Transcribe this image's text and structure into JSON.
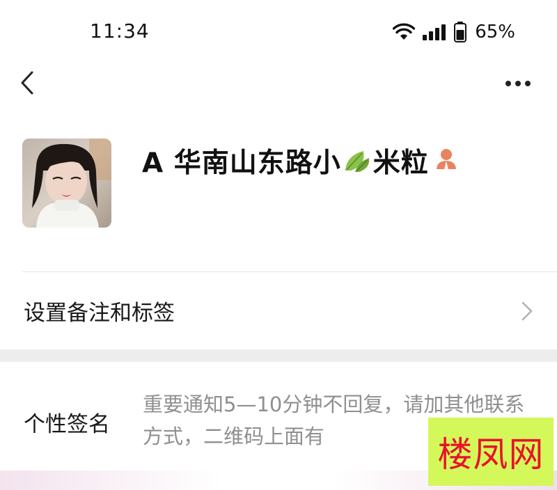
{
  "status_bar": {
    "time": "11:34",
    "battery_percent": "65%",
    "icons": [
      "wifi-icon",
      "signal-icon",
      "battery-icon"
    ]
  },
  "nav": {
    "back_icon": "chevron-left-icon",
    "more_icon": "more-dots-icon"
  },
  "profile": {
    "name_part1": "A 华南山东路小",
    "name_part2": "米粒",
    "name_emoji": "leaf-icon",
    "badge_icon": "contact-person-icon"
  },
  "rows": {
    "remark_label": "设置备注和标签",
    "signature_label": "个性签名",
    "signature_text": "重要通知5—10分钟不回复，请加其他联系方式，二维码上面有"
  },
  "watermark": {
    "text": "楼凤网",
    "bg_color": "#d4f75a",
    "text_color": "#e8122a"
  }
}
